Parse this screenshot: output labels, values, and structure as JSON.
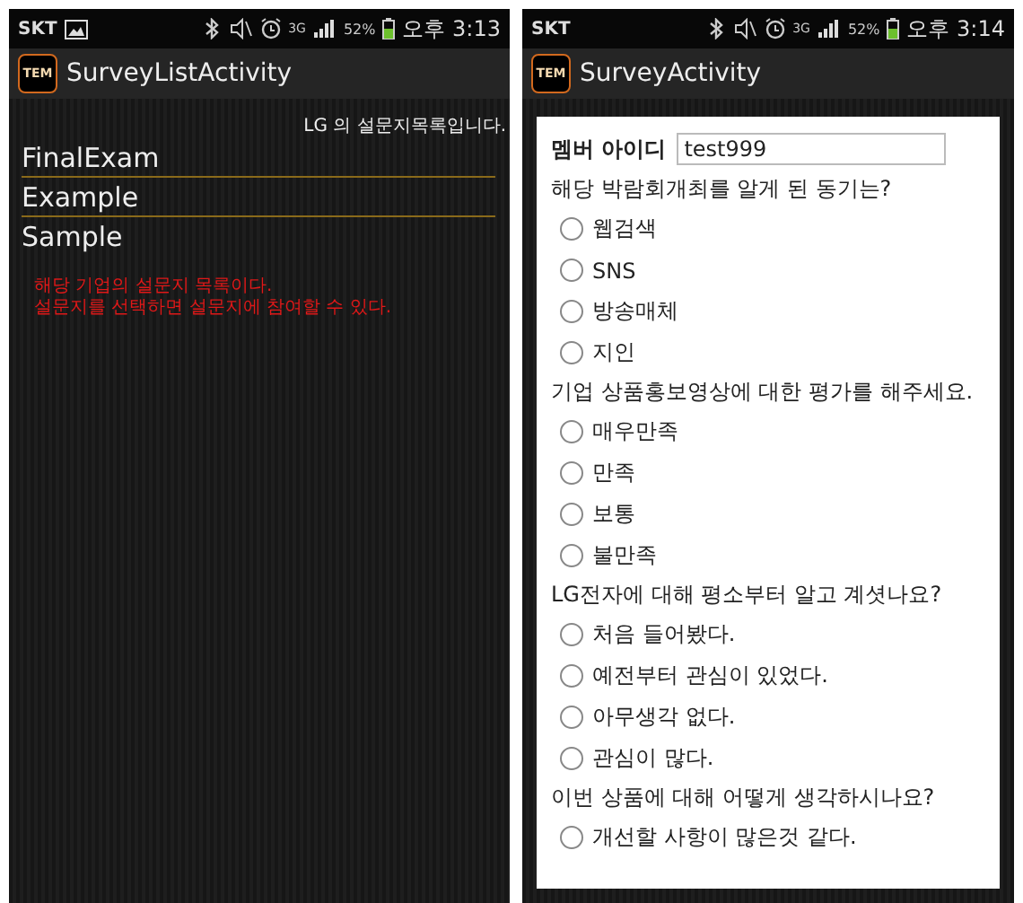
{
  "screens": [
    {
      "kind": "list",
      "status_bar": {
        "carrier": "SKT",
        "show_picture": true,
        "network": "3G",
        "battery": "52%",
        "time": "오후 3:13"
      },
      "app_bar": {
        "logo": "TEM",
        "title": "SurveyListActivity"
      },
      "header": "LG 의 설문지목록입니다.",
      "items": [
        "FinalExam",
        "Example",
        "Sample"
      ],
      "annotation": [
        "해당 기업의 설문지 목록이다.",
        "설문지를 선택하면 설문지에 참여할 수 있다."
      ]
    },
    {
      "kind": "survey",
      "status_bar": {
        "carrier": "SKT",
        "show_picture": false,
        "network": "3G",
        "battery": "52%",
        "time": "오후 3:14"
      },
      "app_bar": {
        "logo": "TEM",
        "title": "SurveyActivity"
      },
      "member": {
        "label": "멤버 아이디",
        "value": "test999"
      },
      "questions": [
        {
          "text": "해당 박람회개최를 알게 된 동기는?",
          "options": [
            {
              "label": "웹검색",
              "selected": false
            },
            {
              "label": "SNS",
              "selected": false
            },
            {
              "label": "방송매체",
              "selected": false
            },
            {
              "label": "지인",
              "selected": false
            }
          ]
        },
        {
          "text": "기업 상품홍보영상에 대한 평가를 해주세요.",
          "options": [
            {
              "label": "매우만족",
              "selected": false
            },
            {
              "label": "만족",
              "selected": false
            },
            {
              "label": "보통",
              "selected": false
            },
            {
              "label": "불만족",
              "selected": false
            }
          ]
        },
        {
          "text": "LG전자에 대해 평소부터 알고 계셧나요?",
          "options": [
            {
              "label": "처음 들어봤다.",
              "selected": false
            },
            {
              "label": "예전부터 관심이 있었다.",
              "selected": false
            },
            {
              "label": "아무생각 없다.",
              "selected": false
            },
            {
              "label": "관심이 많다.",
              "selected": false
            }
          ]
        },
        {
          "text": "이번 상품에 대해 어떻게 생각하시나요?",
          "options": [
            {
              "label": "개선할 사항이 많은것 같다.",
              "selected": false
            }
          ]
        }
      ]
    }
  ]
}
